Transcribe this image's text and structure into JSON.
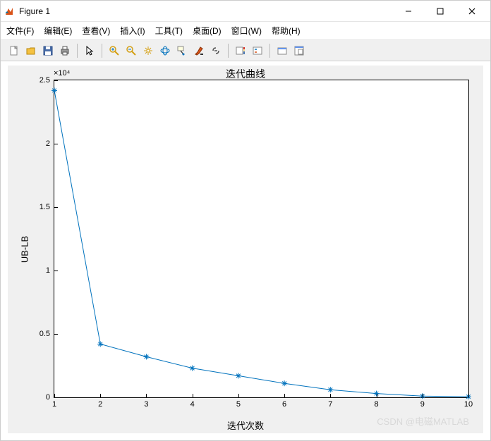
{
  "window": {
    "title": "Figure 1"
  },
  "menu": {
    "items": [
      "文件(F)",
      "编辑(E)",
      "查看(V)",
      "插入(I)",
      "工具(T)",
      "桌面(D)",
      "窗口(W)",
      "帮助(H)"
    ]
  },
  "toolbar": {
    "icons": [
      "new-file-icon",
      "open-file-icon",
      "save-icon",
      "print-icon",
      "pointer-icon",
      "zoom-in-icon",
      "zoom-out-icon",
      "pan-icon",
      "rotate3d-icon",
      "datatip-icon",
      "brush-icon",
      "link-icon",
      "colorbar-icon",
      "legend-icon",
      "float-icon",
      "dock-icon"
    ]
  },
  "chart_data": {
    "type": "line",
    "title": "迭代曲线",
    "xlabel": "迭代次数",
    "ylabel": "UB-LB",
    "x": [
      1,
      2,
      3,
      4,
      5,
      6,
      7,
      8,
      9,
      10
    ],
    "y": [
      24200,
      4200,
      3200,
      2300,
      1700,
      1100,
      600,
      300,
      100,
      50
    ],
    "y_exponent_label": "×10⁴",
    "y_scale": 10000,
    "xlim": [
      1,
      10
    ],
    "ylim": [
      0,
      25000
    ],
    "xticks": [
      1,
      2,
      3,
      4,
      5,
      6,
      7,
      8,
      9,
      10
    ],
    "yticks": [
      0,
      5000,
      10000,
      15000,
      20000,
      25000
    ],
    "ytick_labels": [
      "0",
      "0.5",
      "1",
      "1.5",
      "2",
      "2.5"
    ],
    "line_color": "#0072bd",
    "marker": "*"
  },
  "watermark": "CSDN @电磁MATLAB"
}
